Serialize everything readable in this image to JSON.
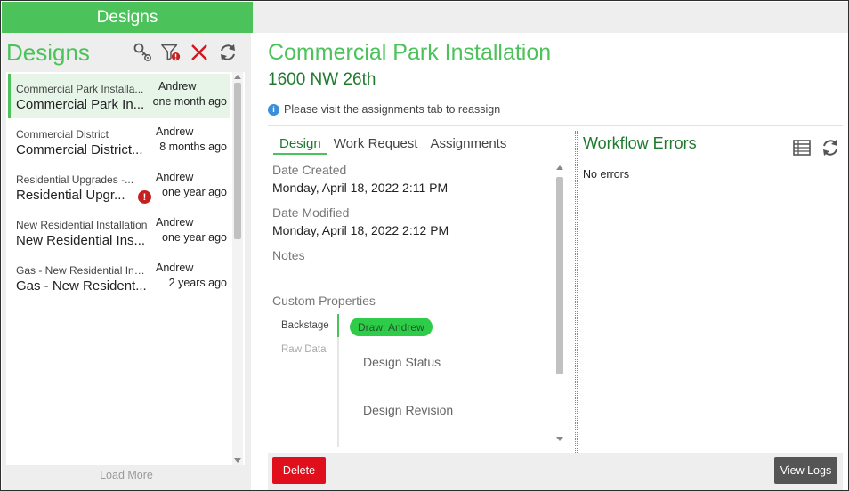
{
  "top_tab": {
    "label": "Designs"
  },
  "left": {
    "title": "Designs",
    "load_more": "Load More",
    "items": [
      {
        "sub": "Commercial Park Installa...",
        "main": "Commercial Park In...",
        "user": "Andrew",
        "time": "one month ago",
        "alert": false,
        "selected": true
      },
      {
        "sub": "Commercial District",
        "main": "Commercial District...",
        "user": "Andrew",
        "time": "8 months ago",
        "alert": false,
        "selected": false
      },
      {
        "sub": "Residential Upgrades -...",
        "main": "Residential Upgr...",
        "user": "Andrew",
        "time": "one year ago",
        "alert": true,
        "selected": false
      },
      {
        "sub": "New Residential Installation",
        "main": "New Residential Ins...",
        "user": "Andrew",
        "time": "one year ago",
        "alert": false,
        "selected": false
      },
      {
        "sub": "Gas - New Residential Inst...",
        "main": "Gas - New Resident...",
        "user": "Andrew",
        "time": "2 years ago",
        "alert": false,
        "selected": false
      }
    ],
    "alert_glyph": "!",
    "icons": [
      "key-settings-icon",
      "filter-alert-icon",
      "close-icon",
      "refresh-icon"
    ]
  },
  "main": {
    "title": "Commercial Park Installation",
    "subtitle": "1600 NW 26th",
    "info_glyph": "i",
    "info_text": "Please visit the assignments tab to reassign",
    "tabs": [
      "Design",
      "Work Request",
      "Assignments"
    ],
    "fields": {
      "date_created_label": "Date Created",
      "date_created_value": "Monday, April 18, 2022 2:11 PM",
      "date_modified_label": "Date Modified",
      "date_modified_value": "Monday, April 18, 2022 2:12 PM",
      "notes_label": "Notes",
      "custom_props_label": "Custom Properties"
    },
    "custom_props": {
      "side_tabs": [
        "Backstage",
        "Raw Data"
      ],
      "pill": "Draw: Andrew",
      "props": [
        "Design Status",
        "Design Revision"
      ]
    },
    "workflow": {
      "title": "Workflow Errors",
      "status": "No errors"
    },
    "footer": {
      "delete_label": "Delete",
      "logs_label": "View Logs"
    }
  },
  "colors": {
    "accent": "#4cc25a",
    "dark_green": "#1f7a2e",
    "danger": "#e00f1c",
    "info": "#3b8fd9"
  }
}
